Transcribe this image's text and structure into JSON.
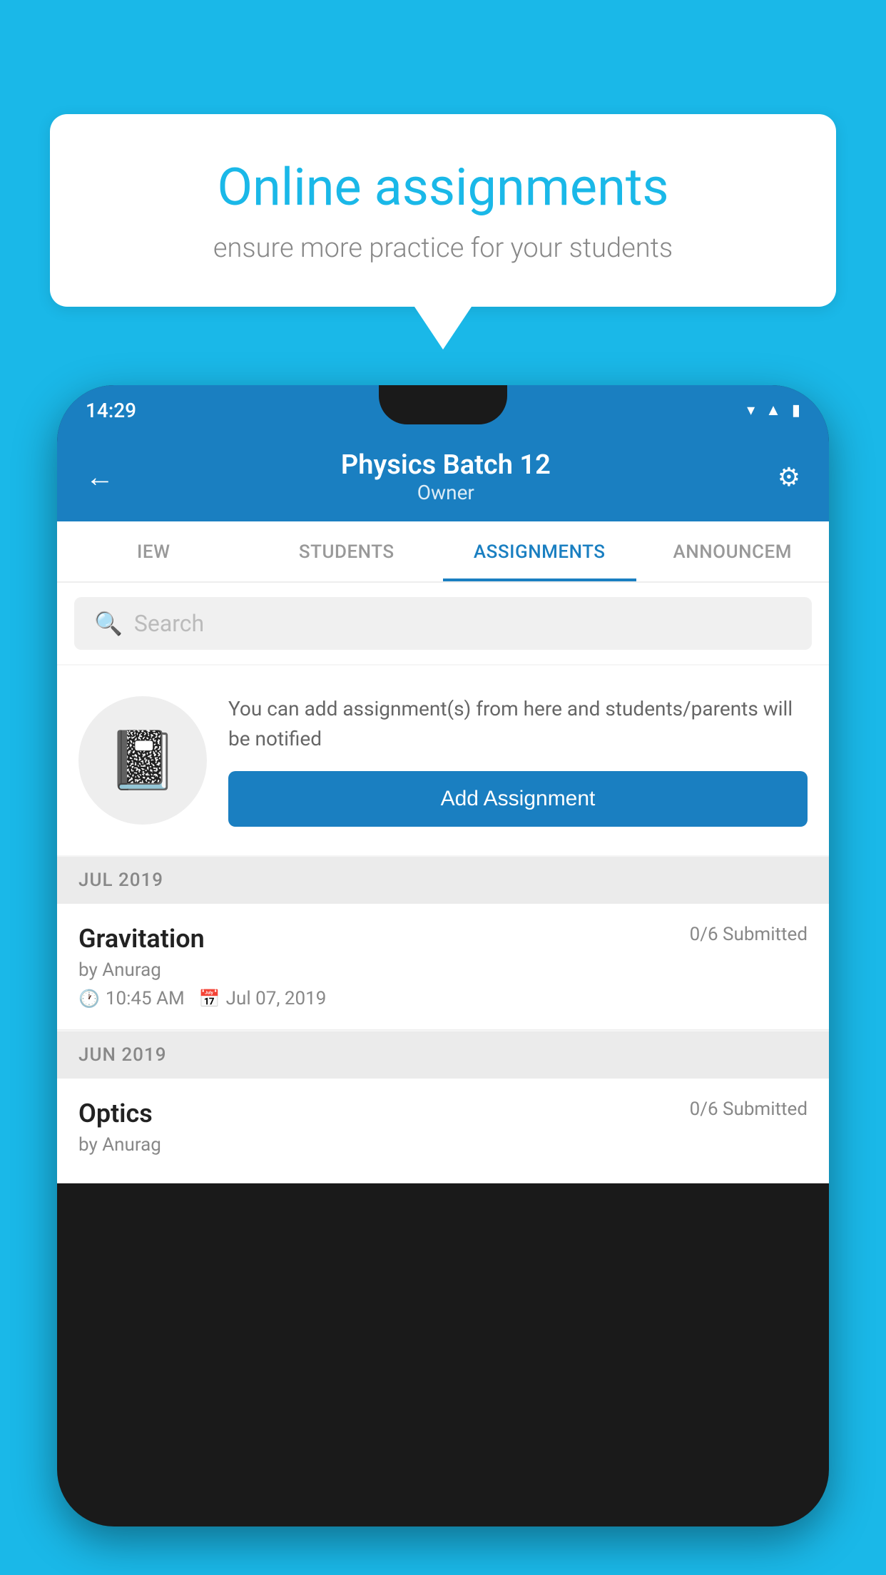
{
  "background_color": "#1ab8e8",
  "speech_bubble": {
    "title": "Online assignments",
    "subtitle": "ensure more practice for your students"
  },
  "phone": {
    "status_bar": {
      "time": "14:29",
      "icons": [
        "wifi",
        "signal",
        "battery"
      ]
    },
    "header": {
      "title": "Physics Batch 12",
      "subtitle": "Owner",
      "back_icon": "←",
      "settings_icon": "⚙"
    },
    "tabs": [
      {
        "label": "IEW",
        "active": false
      },
      {
        "label": "STUDENTS",
        "active": false
      },
      {
        "label": "ASSIGNMENTS",
        "active": true
      },
      {
        "label": "ANNOUNCEM",
        "active": false
      }
    ],
    "search": {
      "placeholder": "Search"
    },
    "add_assignment_section": {
      "info_text": "You can add assignment(s) from here and students/parents will be notified",
      "button_label": "Add Assignment"
    },
    "sections": [
      {
        "month_label": "JUL 2019",
        "assignments": [
          {
            "name": "Gravitation",
            "submitted": "0/6 Submitted",
            "author": "by Anurag",
            "time": "10:45 AM",
            "date": "Jul 07, 2019"
          }
        ]
      },
      {
        "month_label": "JUN 2019",
        "assignments": [
          {
            "name": "Optics",
            "submitted": "0/6 Submitted",
            "author": "by Anurag",
            "time": "",
            "date": ""
          }
        ]
      }
    ]
  }
}
